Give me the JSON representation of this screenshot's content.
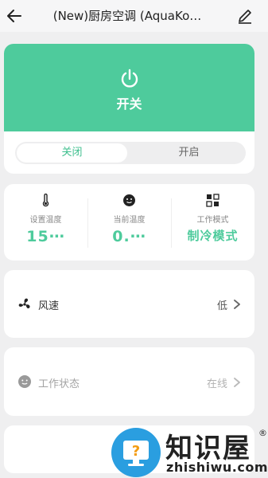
{
  "header": {
    "title": "(New)厨房空调 (AquaKo…",
    "back_icon": "back-arrow-icon",
    "edit_icon": "pencil-icon"
  },
  "power": {
    "label": "开关",
    "icon": "power-icon",
    "accent": "#4ecb9c",
    "segment": {
      "off": "关闭",
      "on": "开启",
      "selected": "关闭"
    }
  },
  "stats": [
    {
      "icon": "thermometer-icon",
      "label": "设置温度",
      "value": "15⋯"
    },
    {
      "icon": "face-icon",
      "label": "当前温度",
      "value": "0.⋯"
    },
    {
      "icon": "grid-mode-icon",
      "label": "工作模式",
      "value": "制冷模式"
    }
  ],
  "fan": {
    "icon": "fan-icon",
    "label": "风速",
    "value": "低"
  },
  "work_status": {
    "icon": "face-icon",
    "label": "工作状态",
    "value": "在线"
  },
  "watermark": {
    "cn": "知识屋",
    "reg": "®",
    "url": "zhishiwu.com",
    "glyph": "?"
  }
}
